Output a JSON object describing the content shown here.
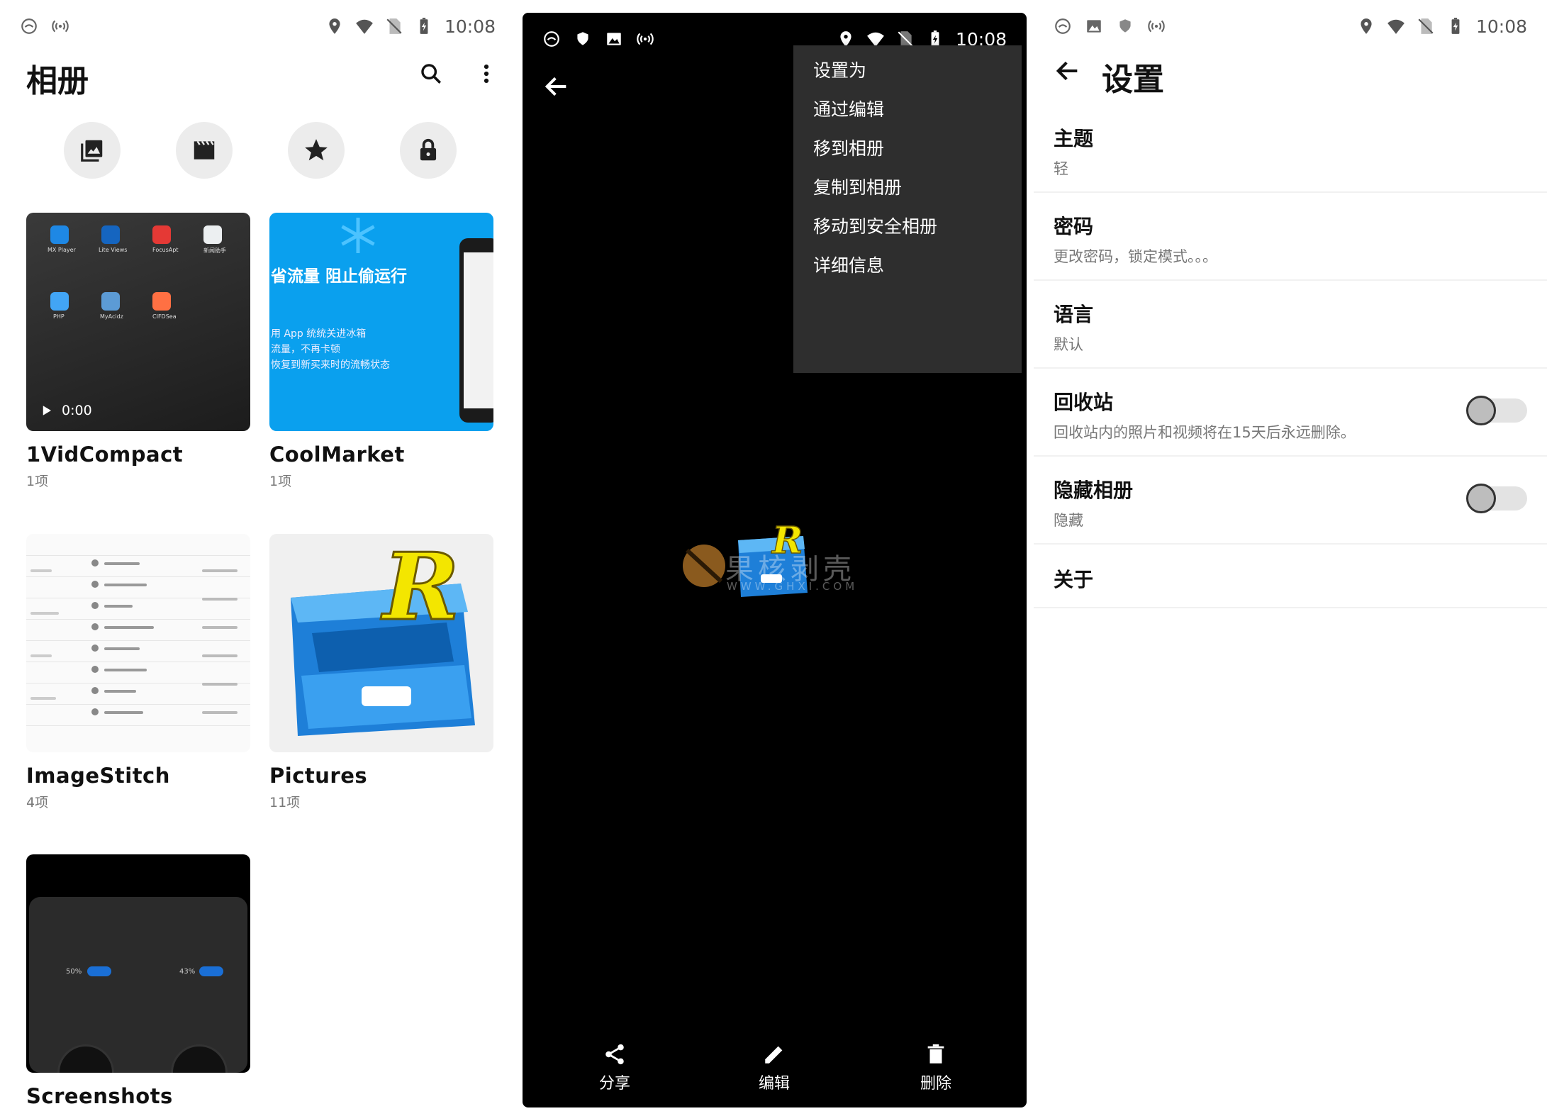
{
  "album_screen": {
    "status": {
      "time": "10:08"
    },
    "title": "相册",
    "albums": [
      {
        "name": "1VidCompact",
        "count": "1项",
        "duration": "0:00",
        "apps": [
          "MX Player",
          "Lite Views",
          "FocusApt",
          "新闻助手",
          "PHP",
          "MyAcidz",
          "CIFDSea"
        ]
      },
      {
        "name": "CoolMarket",
        "count": "1项",
        "headline": "省流量 阻止偷运行",
        "lines": [
          "用 App 统统关进冰箱",
          "流量，不再卡顿",
          "恢复到新买来时的流畅状态"
        ]
      },
      {
        "name": "ImageStitch",
        "count": "4项"
      },
      {
        "name": "Pictures",
        "count": "11项"
      },
      {
        "name": "Screenshots",
        "count": "",
        "pcts": [
          "50%",
          "43%"
        ]
      }
    ]
  },
  "viewer_screen": {
    "status": {
      "time": "10:08"
    },
    "menu": [
      "设置为",
      "通过编辑",
      "移到相册",
      "复制到相册",
      "移动到安全相册",
      "详细信息"
    ],
    "watermark": "果核剥壳",
    "watermark_url": "WWW.GHXI.COM",
    "actions": {
      "share": "分享",
      "edit": "编辑",
      "delete": "删除"
    }
  },
  "settings_screen": {
    "status": {
      "time": "10:08"
    },
    "title": "设置",
    "items": [
      {
        "title": "主题",
        "sub": "轻"
      },
      {
        "title": "密码",
        "sub": "更改密码，锁定模式。。。"
      },
      {
        "title": "语言",
        "sub": "默认"
      },
      {
        "title": "回收站",
        "sub": "回收站内的照片和视频将在15天后永远删除。",
        "toggle": false
      },
      {
        "title": "隐藏相册",
        "sub": "隐藏",
        "toggle": false
      },
      {
        "title": "关于",
        "sub": ""
      }
    ]
  },
  "colors": {
    "toggle_off": "#bdbdbd",
    "menu_bg": "#2e2e2e",
    "accent_blue": "#0aa0ee"
  }
}
